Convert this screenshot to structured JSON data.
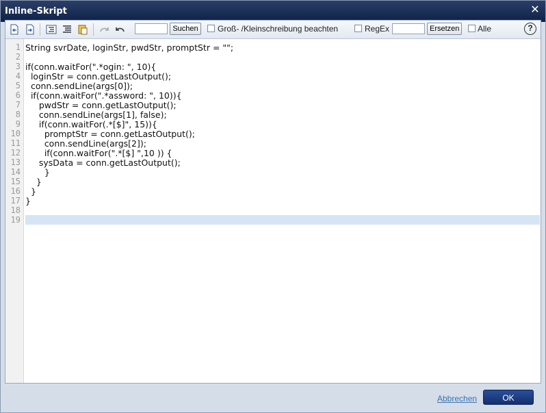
{
  "window": {
    "title": "Inline-Skript"
  },
  "toolbar": {
    "search_value": "",
    "search_button": "Suchen",
    "case_label": "Groß- /Kleinschreibung beachten",
    "regex_label": "RegEx",
    "replace_value": "",
    "replace_button": "Ersetzen",
    "all_label": "Alle",
    "help_label": "?"
  },
  "editor": {
    "line_numbers": [
      "1",
      "2",
      "3",
      "4",
      "5",
      "6",
      "7",
      "8",
      "9",
      "10",
      "11",
      "12",
      "13",
      "14",
      "15",
      "16",
      "17",
      "18",
      "19"
    ],
    "lines": [
      "String svrDate, loginStr, pwdStr, promptStr = \"\";",
      "",
      "if(conn.waitFor(\".*ogin: \", 10){",
      "  loginStr = conn.getLastOutput();",
      "  conn.sendLine(args[0]);",
      "  if(conn.waitFor(\".*assword: \", 10)){",
      "     pwdStr = conn.getLastOutput();",
      "     conn.sendLine(args[1], false);",
      "     if(conn.waitFor(.*[$]\", 15)){",
      "       promptStr = conn.getLastOutput();",
      "       conn.sendLine(args[2]);",
      "       if(conn.waitFor(\".*[$] \",10 )) {",
      "     sysData = conn.getLastOutput();",
      "       }",
      "    }",
      "  }",
      "}",
      "",
      ""
    ],
    "active_line": 19
  },
  "footer": {
    "cancel_label": "Abbrechen",
    "ok_label": "OK"
  }
}
